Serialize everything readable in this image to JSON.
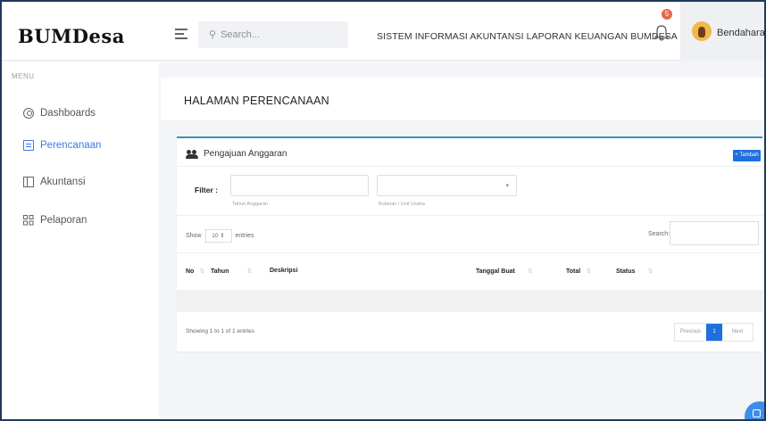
{
  "header": {
    "brand": "BUMDesa",
    "search_placeholder": "Search...",
    "system_title": "SISTEM INFORMASI AKUNTANSI LAPORAN KEUANGAN BUMDESA",
    "notification_count": "5",
    "user_name": "Bendahara"
  },
  "sidebar": {
    "menu_heading": "MENU",
    "items": [
      {
        "label": "Dashboards",
        "icon": "dashboard-icon",
        "active": false
      },
      {
        "label": "Perencanaan",
        "icon": "clipboard-icon",
        "active": true
      },
      {
        "label": "Akuntansi",
        "icon": "book-icon",
        "active": false
      },
      {
        "label": "Pelaporan",
        "icon": "grid-icon",
        "active": false
      }
    ]
  },
  "main": {
    "page_title": "HALAMAN PERENCANAAN",
    "card": {
      "title": "Pengajuan Anggaran",
      "add_button": "+ Tambah",
      "filter_label": "Filter :",
      "filter_year_help": "Tahun Anggaran",
      "filter_unit_help": "Bulanan / Unit Usaha",
      "show_label": "Show",
      "entries_value": "10",
      "entries_label": "entries",
      "search_label": "Search:",
      "columns": [
        "No",
        "Tahun",
        "Deskripsi",
        "Tanggal Buat",
        "Total",
        "Status"
      ],
      "info": "Showing 1 to 1 of 1 entries",
      "pagination": {
        "previous": "Previous",
        "current": "1",
        "next": "Next"
      }
    }
  },
  "colors": {
    "accent": "#3f7ae0",
    "button": "#1e6fe0",
    "badge": "#e46a4e",
    "card_border": "#3c8dbc"
  }
}
